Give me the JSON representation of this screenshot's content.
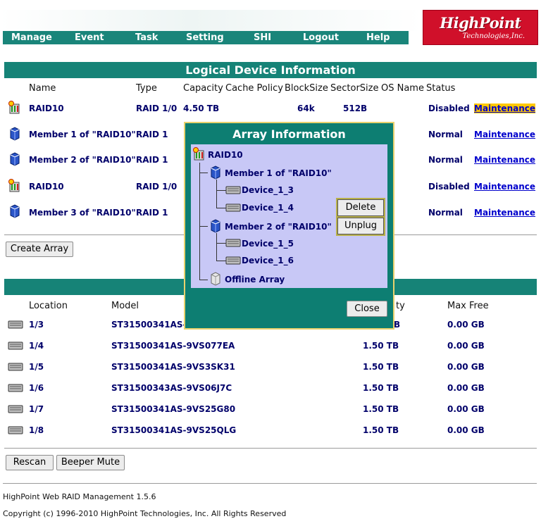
{
  "nav": {
    "items": [
      "Manage",
      "Event",
      "Task",
      "Setting",
      "SHI",
      "Logout",
      "Help"
    ],
    "logo_main": "HighPoint",
    "logo_sub": "Technologies,Inc."
  },
  "logical": {
    "header": "Logical Device Information",
    "columns": [
      "Name",
      "Type",
      "Capacity",
      "Cache Policy",
      "BlockSize",
      "SectorSize",
      "OS Name",
      "Status"
    ],
    "rows": [
      {
        "name": "RAID10",
        "type": "RAID 1/0",
        "capacity": "4.50 TB",
        "blocksize": "64k",
        "sectorsize": "512B",
        "status": "Disabled",
        "action": "Maintenance",
        "icon": "raid-warning-icon"
      },
      {
        "name": "Member 1 of \"RAID10\"",
        "type": "RAID 1",
        "capacity": "",
        "blocksize": "",
        "sectorsize": "",
        "status": "Normal",
        "action": "Maintenance",
        "icon": "array-icon"
      },
      {
        "name": "Member 2 of \"RAID10\"",
        "type": "RAID 1",
        "capacity": "",
        "blocksize": "",
        "sectorsize": "",
        "status": "Normal",
        "action": "Maintenance",
        "icon": "array-icon"
      },
      {
        "name": "RAID10",
        "type": "RAID 1/0",
        "capacity": "",
        "blocksize": "",
        "sectorsize": "",
        "status": "Disabled",
        "action": "Maintenance",
        "icon": "raid-warning-icon"
      },
      {
        "name": "Member 3 of \"RAID10\"",
        "type": "RAID 1",
        "capacity": "",
        "blocksize": "",
        "sectorsize": "",
        "status": "Normal",
        "action": "Maintenance",
        "icon": "array-icon"
      }
    ],
    "create_button": "Create Array"
  },
  "physical": {
    "header": "",
    "columns": [
      "Location",
      "Model",
      "ty",
      "Max Free"
    ],
    "rows": [
      {
        "location": "1/3",
        "model": "ST31500341AS-",
        "capacity": "B",
        "maxfree": "0.00 GB"
      },
      {
        "location": "1/4",
        "model": "ST31500341AS-9VS077EA",
        "capacity": "1.50 TB",
        "maxfree": "0.00 GB"
      },
      {
        "location": "1/5",
        "model": "ST31500341AS-9VS3SK31",
        "capacity": "1.50 TB",
        "maxfree": "0.00 GB"
      },
      {
        "location": "1/6",
        "model": "ST31500343AS-9VS06J7C",
        "capacity": "1.50 TB",
        "maxfree": "0.00 GB"
      },
      {
        "location": "1/7",
        "model": "ST31500341AS-9VS25G80",
        "capacity": "1.50 TB",
        "maxfree": "0.00 GB"
      },
      {
        "location": "1/8",
        "model": "ST31500341AS-9VS25QLG",
        "capacity": "1.50 TB",
        "maxfree": "0.00 GB"
      }
    ],
    "rescan_button": "Rescan",
    "beeper_button": "Beeper Mute"
  },
  "dialog": {
    "title": "Array Information",
    "tree": {
      "root": "RAID10",
      "member1": "Member 1 of \"RAID10\"",
      "m1_dev1": "Device_1_3",
      "m1_dev2": "Device_1_4",
      "member2": "Member 2 of \"RAID10\"",
      "m2_dev1": "Device_1_5",
      "m2_dev2": "Device_1_6",
      "offline": "Offline Array"
    },
    "delete_button": "Delete",
    "unplug_button": "Unplug",
    "close_button": "Close"
  },
  "footer": {
    "version": "HighPoint Web RAID Management 1.5.6",
    "copyright": "Copyright (c) 1996-2010 HighPoint Technologies, Inc. All Rights Reserved"
  },
  "colors": {
    "accent": "#168377",
    "link": "#0000cc",
    "cell_text": "#00006a",
    "highlight": "#ffc800",
    "logo_red": "#d0102a",
    "tree_bg": "#c8c8f6"
  }
}
